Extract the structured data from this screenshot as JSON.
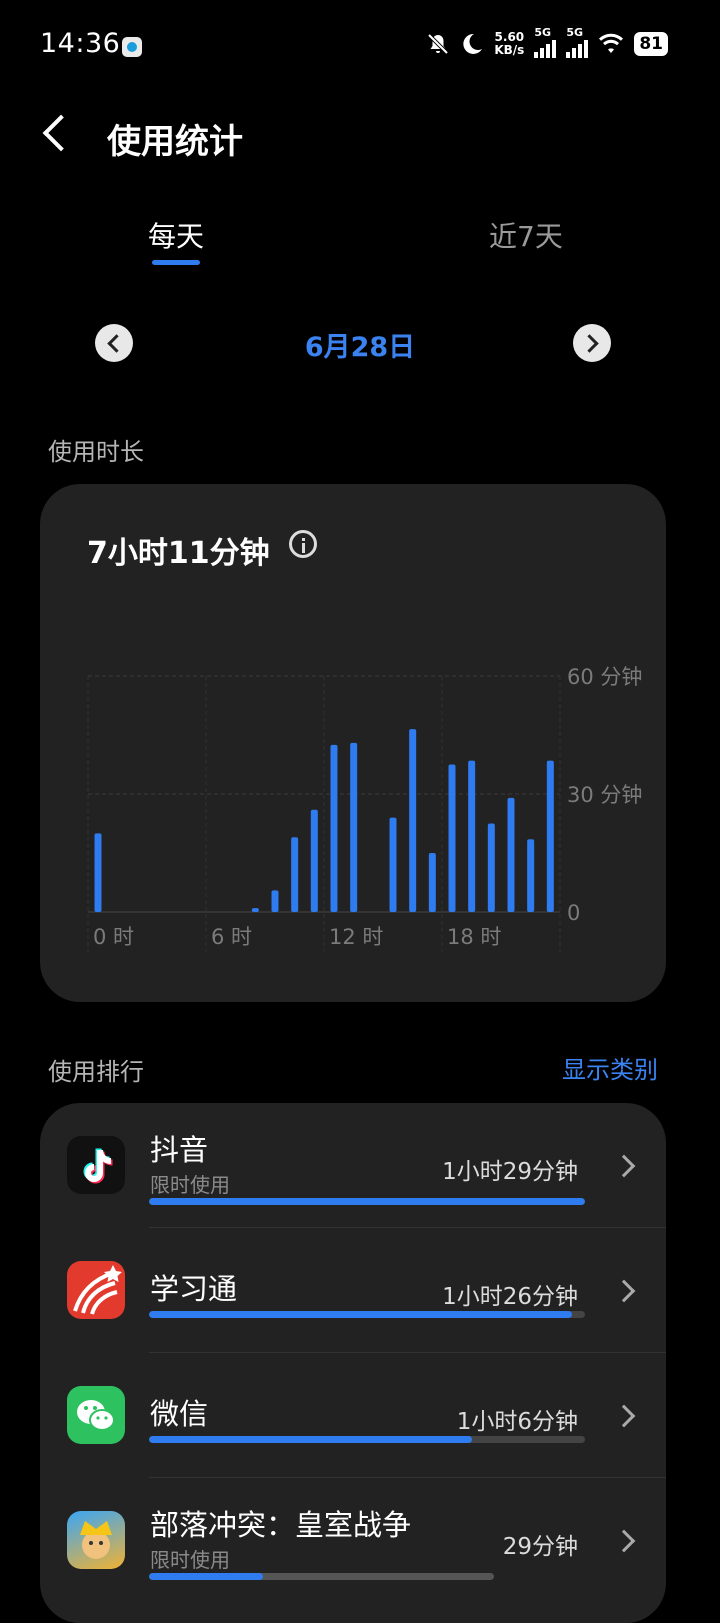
{
  "status_bar": {
    "time": "14:36",
    "speed_value": "5.60",
    "speed_unit": "KB/s",
    "sim1_label": "5G",
    "sim2_label": "5G",
    "battery": "81"
  },
  "header": {
    "title": "使用统计"
  },
  "tabs": [
    {
      "label": "每天",
      "active": true
    },
    {
      "label": "近7天",
      "active": false
    }
  ],
  "date_nav": {
    "current": "6月28日"
  },
  "usage": {
    "section_label": "使用时长",
    "total": "7小时11分钟"
  },
  "chart_data": {
    "type": "bar",
    "x_unit": "hour",
    "x_tick_labels": [
      "0 时",
      "6 时",
      "12 时",
      "18 时"
    ],
    "y_tick_labels": [
      "60 分钟",
      "30 分钟",
      "0"
    ],
    "ylim": [
      0,
      60
    ],
    "grid": true,
    "accent": "#2f7bf0",
    "hours": [
      0,
      8,
      9,
      10,
      11,
      12,
      13,
      15,
      16,
      17,
      18,
      19,
      20,
      21,
      22,
      23
    ],
    "values": [
      20,
      1,
      5.5,
      19,
      26,
      42.5,
      43,
      24,
      46.5,
      15,
      37.5,
      38.5,
      22.5,
      29,
      18.5,
      38.5
    ]
  },
  "ranking": {
    "section_label": "使用排行",
    "action_label": "显示类别",
    "apps": [
      {
        "name": "抖音",
        "sub": "限时使用",
        "time": "1小时29分钟",
        "progress": 1.0,
        "icon": "tiktok-icon"
      },
      {
        "name": "学习通",
        "sub": "",
        "time": "1小时26分钟",
        "progress": 0.97,
        "icon": "xuexitong-icon"
      },
      {
        "name": "微信",
        "sub": "",
        "time": "1小时6分钟",
        "progress": 0.74,
        "icon": "wechat-icon"
      },
      {
        "name": "部落冲突：皇室战争",
        "sub": "限时使用",
        "time": "29分钟",
        "progress": 0.33,
        "icon": "clash-royale-icon"
      }
    ]
  }
}
